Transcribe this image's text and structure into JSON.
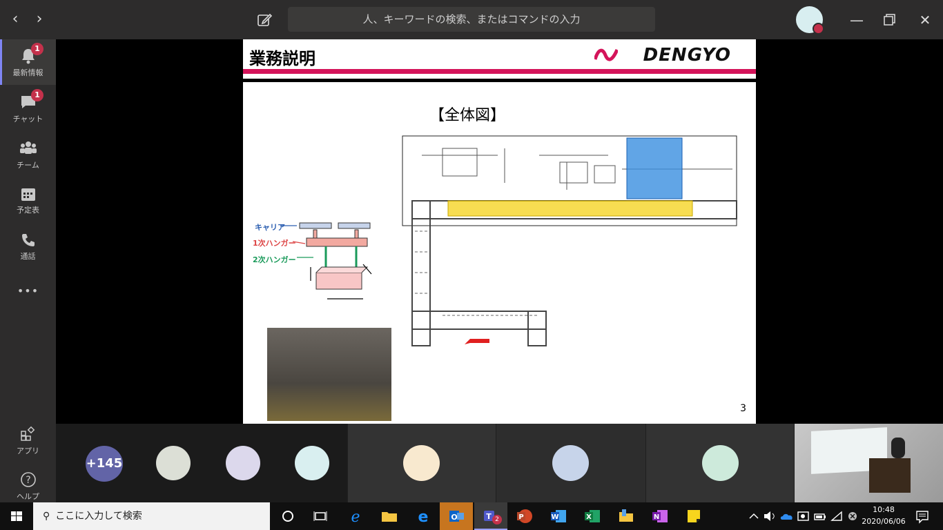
{
  "titlebar": {
    "search_placeholder": "人、キーワードの検索、またはコマンドの入力",
    "back_icon": "chevron-left-icon",
    "forward_icon": "chevron-right-icon",
    "compose_icon": "compose-icon",
    "status_color": "#c4314b"
  },
  "rail": {
    "items": [
      {
        "label": "最新情報",
        "icon": "bell-icon",
        "badge": "1",
        "active": true
      },
      {
        "label": "チャット",
        "icon": "chat-icon",
        "badge": "1"
      },
      {
        "label": "チーム",
        "icon": "teams-icon"
      },
      {
        "label": "予定表",
        "icon": "calendar-icon"
      },
      {
        "label": "通話",
        "icon": "phone-icon"
      }
    ],
    "more": "•••",
    "apps": "アプリ",
    "help": "ヘルプ"
  },
  "slide": {
    "title": "業務説明",
    "brand": "DENGYO",
    "figure_title": "【全体図】",
    "labels": {
      "carrier": "キャリア",
      "hanger1": "1次ハンガー",
      "hanger2": "2次ハンガー"
    },
    "page_number": "3"
  },
  "participants": {
    "overflow": "+145",
    "colors": [
      "#dcdfd6",
      "#dcd8ec",
      "#d9eff0",
      "#f8e9cf",
      "#c7d4ea",
      "#cdeadb"
    ]
  },
  "taskbar": {
    "search_placeholder": "ここに入力して検索",
    "teams_badge": "2",
    "time": "10:48",
    "date": "2020/06/06"
  }
}
